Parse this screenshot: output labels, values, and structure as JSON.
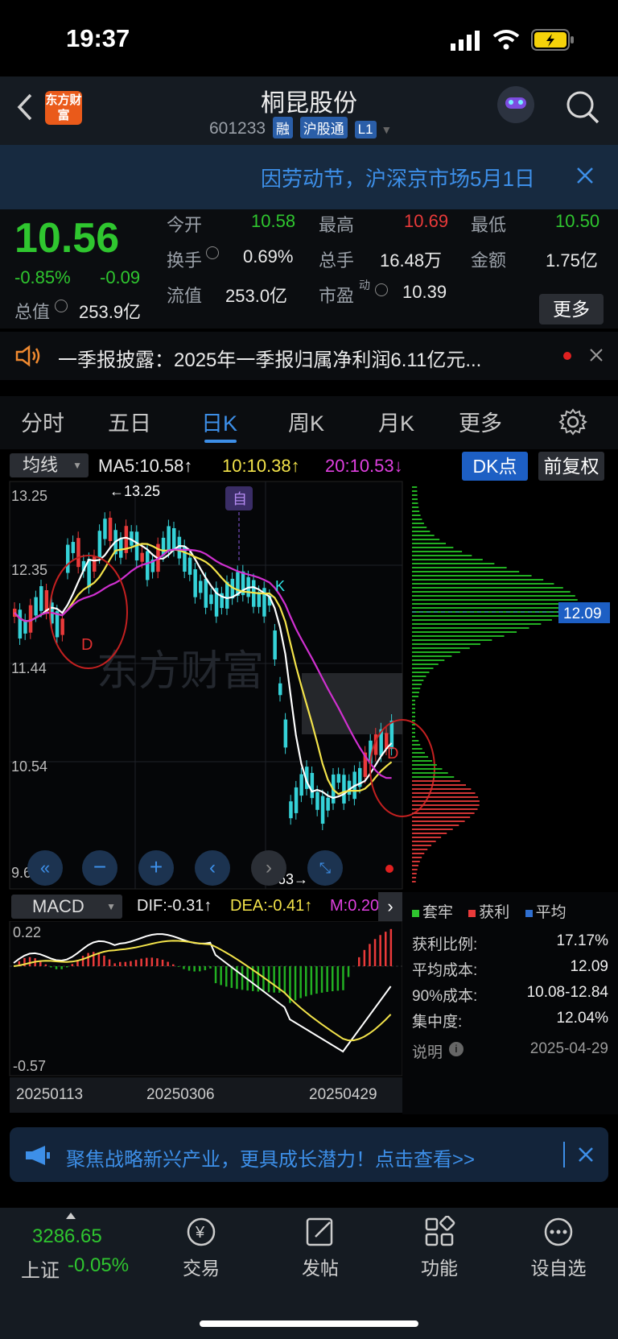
{
  "status": {
    "time": "19:37"
  },
  "header": {
    "title": "桐昆股份",
    "code": "601233",
    "tags": [
      "融",
      "沪股通",
      "L1"
    ],
    "logo_text": "东方财富"
  },
  "banner": {
    "text": "因劳动节，沪深京市场5月1日"
  },
  "quote": {
    "price": "10.56",
    "change_pct": "-0.85%",
    "change": "-0.09",
    "open_label": "今开",
    "open": "10.58",
    "high_label": "最高",
    "high": "10.69",
    "low_label": "最低",
    "low": "10.50",
    "turnover_label": "换手",
    "turnover": "0.69%",
    "volume_label": "总手",
    "volume": "16.48万",
    "amount_label": "金额",
    "amount": "1.75亿",
    "mktcap_label": "总值",
    "mktcap": "253.9亿",
    "float_label": "流值",
    "float": "253.0亿",
    "pe_label": "市盈",
    "pe_sup": "动",
    "pe": "10.39",
    "more": "更多"
  },
  "notice": {
    "text": "一季报披露：2025年一季报归属净利润6.11亿元..."
  },
  "tabs": [
    "分时",
    "五日",
    "日K",
    "周K",
    "月K",
    "更多"
  ],
  "active_tab": 2,
  "ma": {
    "selector": "均线",
    "ma5": "MA5:10.58↑",
    "ma10": "10:10.38↑",
    "ma20": "20:10.53↓",
    "dk": "DK点",
    "fq": "前复权"
  },
  "chart_data": {
    "type": "candlestick",
    "y_ticks": [
      "13.25",
      "12.35",
      "11.44",
      "10.54",
      "9.63"
    ],
    "max_label": "←13.25",
    "min_label": "9.63→",
    "avg_cost_label": "12.09",
    "marker_zi": "自",
    "marker_k": "K",
    "marker_d": "D",
    "watermark": "东方财富"
  },
  "macd": {
    "selector": "MACD",
    "dif": "DIF:-0.31↑",
    "dea": "DEA:-0.41↑",
    "m": "M:0.20",
    "y_top": "0.22",
    "y_bottom": "-0.57",
    "dates": [
      "20250113",
      "20250306",
      "20250429"
    ]
  },
  "chips": {
    "legend": [
      "套牢",
      "获利",
      "平均"
    ],
    "rows": [
      {
        "label": "获利比例:",
        "value": "17.17%"
      },
      {
        "label": "平均成本:",
        "value": "12.09"
      },
      {
        "label": "90%成本:",
        "value": "10.08-12.84"
      },
      {
        "label": "集中度:",
        "value": "12.04%"
      }
    ],
    "note_label": "说明",
    "date": "2025-04-29"
  },
  "promo": {
    "text": "聚焦战略新兴产业，更具成长潜力！点击查看>>"
  },
  "nav": {
    "index_value": "3286.65",
    "index_name": "上证",
    "index_change": "-0.05%",
    "items": [
      "交易",
      "发帖",
      "功能",
      "设自选"
    ]
  }
}
